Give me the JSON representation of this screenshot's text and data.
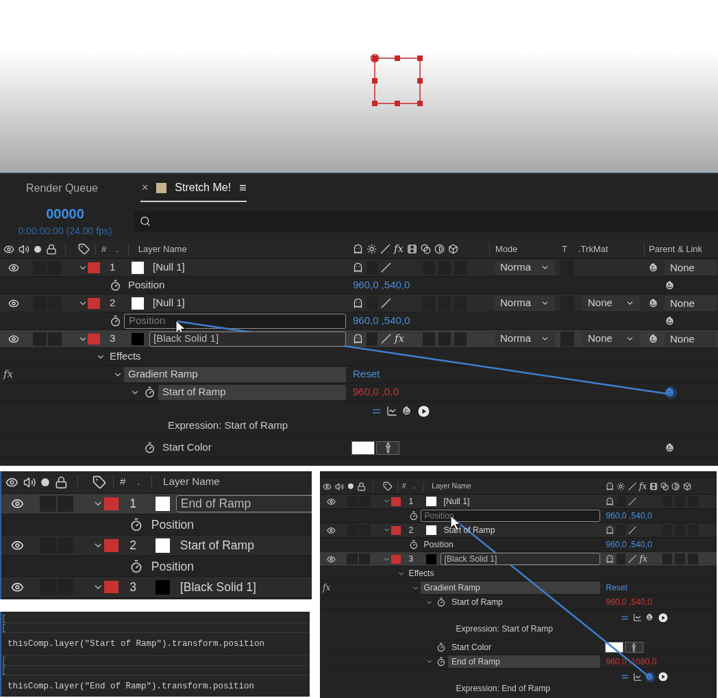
{
  "main_panel": {
    "tabs": [
      {
        "label": "Render Queue",
        "selected": false
      },
      {
        "label": "Stretch Me!",
        "selected": true,
        "close": "×",
        "menu": "≡"
      }
    ],
    "timecode": "00000",
    "timecode_fps": "0:00:00:00 (24.00 fps)",
    "header": {
      "number": "#",
      "dot": ".",
      "layer_name": "Layer Name",
      "fx": "fx",
      "mode": "Mode",
      "t": "T",
      "trkmat": ".TrkMat",
      "parent": "Parent & Link"
    },
    "layers": [
      {
        "number": "1",
        "name": "[Null 1]",
        "color": "#ffffff",
        "visible": true,
        "expanded": true,
        "selected": false,
        "editing": false,
        "mode": "Norma",
        "parent": "None",
        "children": [
          {
            "kind": "property",
            "name": "Position",
            "value": "960,0 ,540,0",
            "expression": false,
            "selected": false,
            "editing": false,
            "pickwhip_active": false
          }
        ]
      },
      {
        "number": "2",
        "name": "[Null 1]",
        "color": "#ffffff",
        "visible": true,
        "expanded": true,
        "selected": false,
        "editing": false,
        "mode": "Norma",
        "trkmat": "None",
        "parent": "None",
        "children": [
          {
            "kind": "property",
            "name": "Position",
            "value": "960,0 ,540,0",
            "expression": false,
            "selected": false,
            "editing": true,
            "pickwhip_active": false
          }
        ]
      },
      {
        "number": "3",
        "name": "[Black Solid 1]",
        "color": "#000000",
        "visible": true,
        "expanded": true,
        "selected": true,
        "editing": true,
        "fx": "fx",
        "mode": "Norma",
        "trkmat": "None",
        "parent": "None",
        "children": [
          {
            "kind": "group",
            "name": "Effects",
            "expanded": true,
            "children": [
              {
                "kind": "effect",
                "badge": "fx",
                "name": "Gradient Ramp",
                "reset": "Reset",
                "selected": true,
                "expanded": true,
                "children": [
                  {
                    "kind": "property",
                    "name": "Start of Ramp",
                    "value": "960,0 ,0,0",
                    "expression": true,
                    "selected": true,
                    "editing": false,
                    "expanded": true,
                    "pickwhip_active": true,
                    "children": [
                      {
                        "kind": "expression",
                        "name": "Expression: Start of Ramp",
                        "pickwhip_active": false
                      }
                    ]
                  },
                  {
                    "kind": "color",
                    "name": "Start Color",
                    "color": "#ffffff",
                    "pickwhip_active": false
                  }
                ]
              }
            ]
          }
        ]
      }
    ]
  },
  "rename_panel": {
    "header": {
      "number": "#",
      "dot": ".",
      "layer_name": "Layer Name"
    },
    "layers": [
      {
        "number": "1",
        "name": "End of Ramp",
        "color": "#ffffff",
        "visible": true,
        "expanded": true,
        "selected": true,
        "editing": true,
        "children": [
          {
            "kind": "property",
            "name": "Position",
            "selected": false,
            "editing": false
          }
        ]
      },
      {
        "number": "2",
        "name": "Start of Ramp",
        "color": "#ffffff",
        "visible": true,
        "expanded": true,
        "selected": false,
        "editing": false,
        "children": [
          {
            "kind": "property",
            "name": "Position",
            "selected": false,
            "editing": false
          }
        ]
      },
      {
        "number": "3",
        "name": "[Black Solid 1]",
        "color": "#000000",
        "visible": true,
        "expanded": true,
        "selected": false,
        "editing": false
      }
    ]
  },
  "code_panel": {
    "lines": [
      {
        "kind": "marker",
        "text": "["
      },
      {
        "kind": "marker",
        "text": "["
      },
      {
        "kind": "code",
        "text": "thisComp.layer(\"Start of Ramp\").transform.position"
      },
      {
        "kind": "marker",
        "text": "["
      },
      {
        "kind": "marker",
        "text": "["
      },
      {
        "kind": "code",
        "text": "thisComp.layer(\"End of Ramp\").transform.position"
      }
    ]
  },
  "linked_panel": {
    "header": {
      "number": "#",
      "dot": ".",
      "layer_name": "Layer Name",
      "fx": "fx"
    },
    "layers": [
      {
        "number": "1",
        "name": "[Null 1]",
        "color": "#ffffff",
        "visible": true,
        "expanded": true,
        "selected": false,
        "editing": false,
        "children": [
          {
            "kind": "property",
            "name": "Position",
            "value": "960,0 ,540,0",
            "expression": false,
            "selected": false,
            "editing": true
          }
        ]
      },
      {
        "number": "2",
        "name": "Start of Ramp",
        "color": "#ffffff",
        "visible": true,
        "expanded": true,
        "selected": false,
        "editing": false,
        "children": [
          {
            "kind": "property",
            "name": "Position",
            "value": "960,0 ,540,0",
            "expression": false,
            "selected": false,
            "editing": false
          }
        ]
      },
      {
        "number": "3",
        "name": "[Black Solid 1]",
        "color": "#000000",
        "visible": true,
        "expanded": true,
        "selected": true,
        "editing": true,
        "fx": "fx",
        "children": [
          {
            "kind": "group",
            "name": "Effects",
            "expanded": true,
            "children": [
              {
                "kind": "effect",
                "badge": "fx",
                "name": "Gradient Ramp",
                "reset": "Reset",
                "selected": true,
                "expanded": true,
                "children": [
                  {
                    "kind": "property",
                    "name": "Start of Ramp",
                    "value": "960,0 ,540,0",
                    "expression": true,
                    "selected": false,
                    "editing": false,
                    "expanded": true,
                    "children": [
                      {
                        "kind": "expression",
                        "name": "Expression: Start of Ramp",
                        "pickwhip_active": false
                      }
                    ]
                  },
                  {
                    "kind": "color",
                    "name": "Start Color",
                    "color": "#ffffff"
                  },
                  {
                    "kind": "property",
                    "name": "End of Ramp",
                    "value": "960,0 ,1080,0",
                    "expression": true,
                    "selected": true,
                    "editing": false,
                    "expanded": true,
                    "children": [
                      {
                        "kind": "expression",
                        "name": "Expression: End of Ramp",
                        "pickwhip_active": true
                      }
                    ]
                  }
                ]
              }
            ]
          }
        ]
      }
    ]
  }
}
